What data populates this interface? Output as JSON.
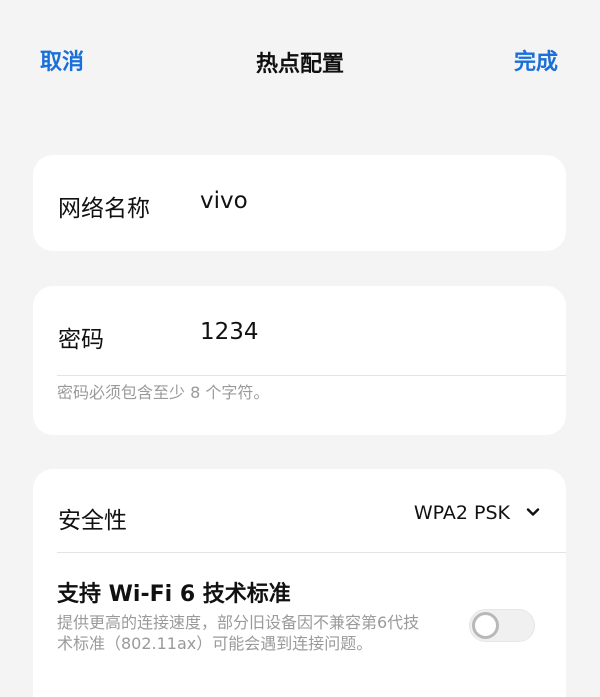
{
  "header": {
    "cancel_label": "取消",
    "title": "热点配置",
    "done_label": "完成"
  },
  "network_name": {
    "label": "网络名称",
    "value": "vivo"
  },
  "password": {
    "label": "密码",
    "value": "1234",
    "hint": "密码必须包含至少 8 个字符。"
  },
  "security": {
    "label": "安全性",
    "selected": "WPA2 PSK"
  },
  "wifi6": {
    "title": "支持 Wi-Fi 6 技术标准",
    "description": "提供更高的连接速度，部分旧设备因不兼容第6代技术标准（802.11ax）可能会遇到连接问题。",
    "enabled": false
  },
  "colors": {
    "accent": "#1a6fd8",
    "background": "#f4f4f4",
    "card": "#ffffff",
    "hint_text": "#9a9a9a"
  },
  "icons": {
    "security_dropdown": "chevron-down-icon",
    "wifi6_toggle": "toggle-switch"
  }
}
